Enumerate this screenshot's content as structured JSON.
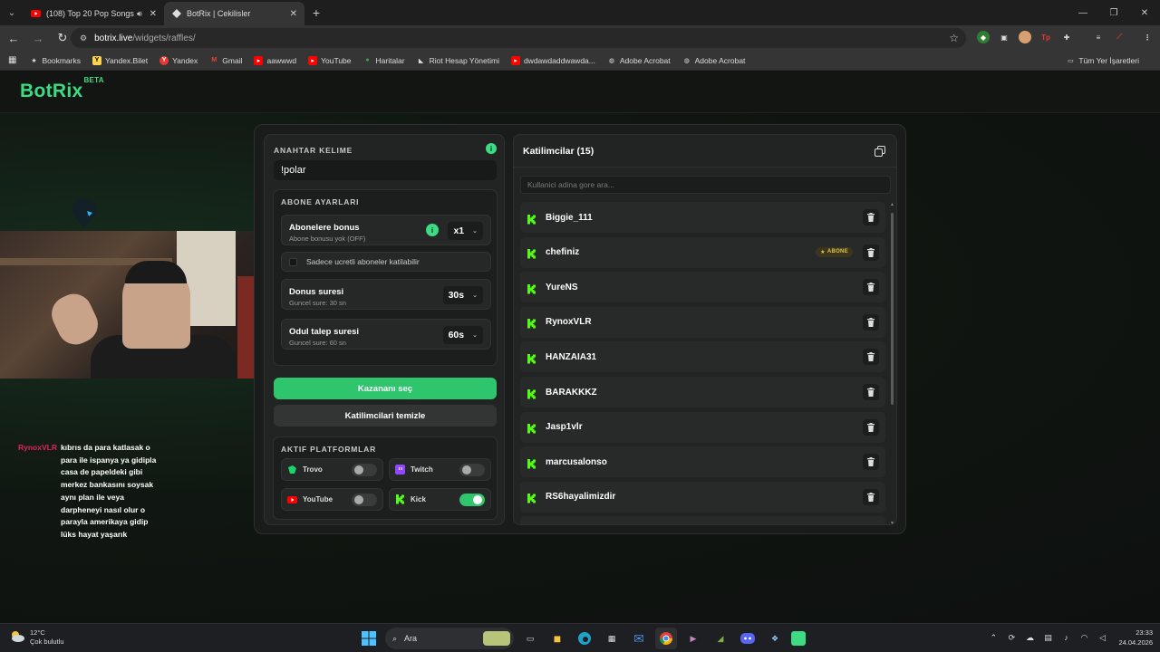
{
  "browser": {
    "tabs": [
      {
        "title": "(108) Top 20 Pop Songs 20",
        "favicon": "youtube-icon",
        "active": false
      },
      {
        "title": "BotRix | Cekilisler",
        "favicon": "botrix-icon",
        "active": true
      }
    ],
    "url_host": "botrix.live",
    "url_path": "/widgets/raffles/",
    "bookmarks": [
      {
        "label": "Bookmarks",
        "icon": "star-icon"
      },
      {
        "label": "Yandex.Bilet",
        "icon": "yandex-bilet-icon"
      },
      {
        "label": "Yandex",
        "icon": "yandex-icon"
      },
      {
        "label": "Gmail",
        "icon": "gmail-icon"
      },
      {
        "label": "aawwwd",
        "icon": "youtube-icon"
      },
      {
        "label": "YouTube",
        "icon": "youtube-icon"
      },
      {
        "label": "Haritalar",
        "icon": "maps-icon"
      },
      {
        "label": "Riot Hesap Yönetimi",
        "icon": "riot-icon"
      },
      {
        "label": "dwdawdaddwawda...",
        "icon": "youtube-icon"
      },
      {
        "label": "Adobe Acrobat",
        "icon": "globe-icon"
      },
      {
        "label": "Adobe Acrobat",
        "icon": "globe-icon"
      }
    ],
    "all_bookmarks": "Tüm Yer İşaretleri"
  },
  "site": {
    "logo": "BotRix",
    "logo_badge": "BETA"
  },
  "chat": {
    "user": "RynoxVLR",
    "message": "kıbrıs da para katlasak o para ile ispanya ya gidipla casa de papeldeki gibi merkez bankasını soysak aynı plan ile veya darpheneyi nasıl olur o parayla amerikaya gidip lüks hayat yaşarık"
  },
  "raffle": {
    "keyword_title": "ANAHTAR KELIME",
    "keyword_value": "!polar",
    "sub_settings_title": "ABONE AYARLARI",
    "sub_bonus": {
      "title": "Abonelere bonus",
      "subtitle": "Abone bonusu yok (OFF)",
      "value": "x1"
    },
    "paid_only": "Sadece ucretli aboneler katilabilir",
    "bonus_time": {
      "title": "Donus suresi",
      "subtitle": "Guncel sure: 30 sn",
      "value": "30s"
    },
    "claim_time": {
      "title": "Odul talep suresi",
      "subtitle": "Guncel sure: 60 sn",
      "value": "60s"
    },
    "pick_winner": "Kazananı seç",
    "clear_participants": "Katilimcilari temizle",
    "platforms_title": "AKTIF PLATFORMLAR",
    "platforms": [
      {
        "name": "Trovo",
        "enabled": false,
        "color": "#19d66b"
      },
      {
        "name": "Twitch",
        "enabled": false,
        "color": "#9146ff"
      },
      {
        "name": "YouTube",
        "enabled": false,
        "color": "#ff0000"
      },
      {
        "name": "Kick",
        "enabled": true,
        "color": "#53fc18"
      }
    ]
  },
  "participants": {
    "title": "Katilimcilar (15)",
    "search_placeholder": "Kullanici adina gore ara...",
    "subscriber_badge": "ABONE",
    "list": [
      {
        "name": "Biggie_111",
        "subscriber": false
      },
      {
        "name": "chefiniz",
        "subscriber": true
      },
      {
        "name": "YureNS",
        "subscriber": false
      },
      {
        "name": "RynoxVLR",
        "subscriber": false
      },
      {
        "name": "HANZAIA31",
        "subscriber": false
      },
      {
        "name": "BARAKKKZ",
        "subscriber": false
      },
      {
        "name": "Jasp1vlr",
        "subscriber": false
      },
      {
        "name": "marcusalonso",
        "subscriber": false
      },
      {
        "name": "RS6hayalimizdir",
        "subscriber": false
      }
    ]
  },
  "taskbar": {
    "temperature": "12°C",
    "weather": "Çok bulutlu",
    "search_label": "Ara",
    "time": "23:33",
    "date": "24.04.2026"
  },
  "colors": {
    "accent": "#3ddc84",
    "primary_button": "#2fc56d",
    "kick_green": "#53fc18",
    "chat_user": "#e0245e",
    "badge_gold": "#e4c84a"
  }
}
